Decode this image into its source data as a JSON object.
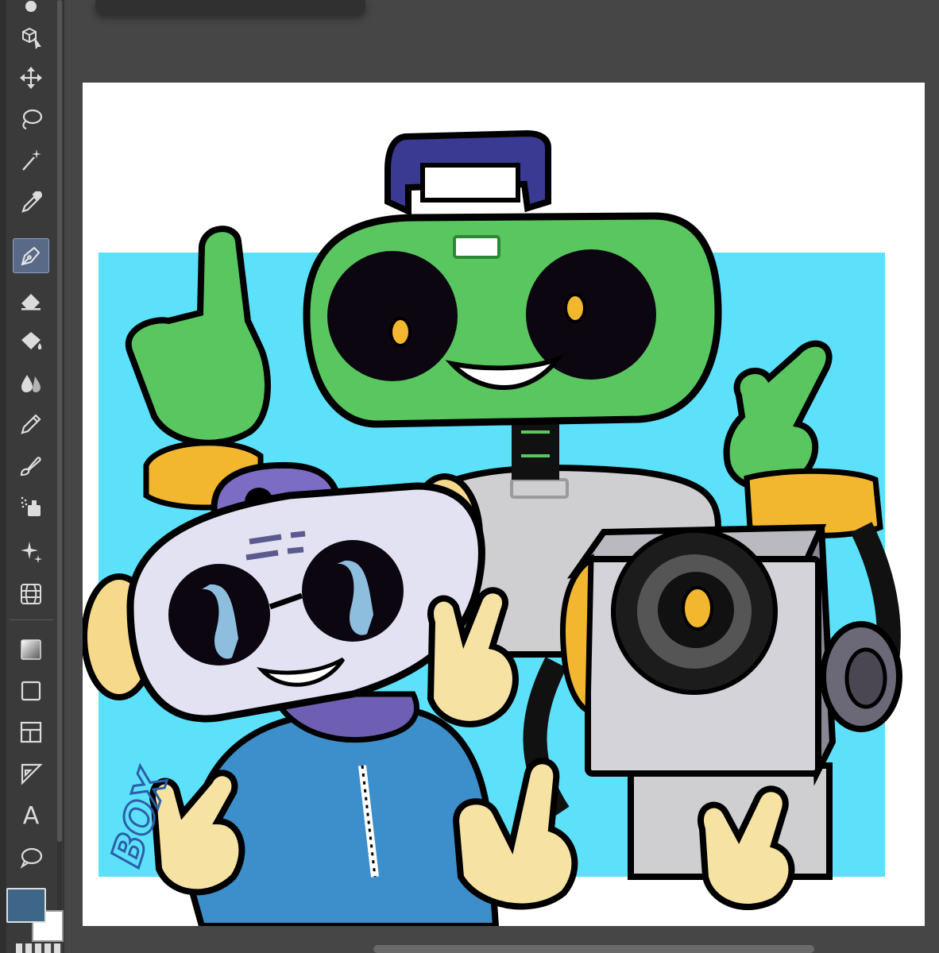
{
  "app": {
    "toolbar": {
      "tools": [
        {
          "name": "object-select-tool",
          "icon": "object-select-icon"
        },
        {
          "name": "move-tool",
          "icon": "move-arrows-icon"
        },
        {
          "name": "lasso-tool",
          "icon": "lasso-icon"
        },
        {
          "name": "magic-wand-tool",
          "icon": "magic-wand-icon"
        },
        {
          "name": "eyedropper-tool",
          "icon": "eyedropper-icon"
        },
        {
          "name": "pen-tool",
          "icon": "pen-nib-icon",
          "active": true
        },
        {
          "name": "eraser-tool",
          "icon": "eraser-icon"
        },
        {
          "name": "fill-tool",
          "icon": "paint-bucket-icon"
        },
        {
          "name": "blend-tool",
          "icon": "water-drops-icon"
        },
        {
          "name": "pencil-tool",
          "icon": "pencil-icon"
        },
        {
          "name": "brush-tool",
          "icon": "brush-icon"
        },
        {
          "name": "airbrush-tool",
          "icon": "airbrush-icon"
        },
        {
          "name": "decoration-tool",
          "icon": "sparkle-icon"
        },
        {
          "name": "mesh-transform-tool",
          "icon": "grid-sphere-icon"
        },
        {
          "name": "gradient-tool",
          "icon": "gradient-icon"
        },
        {
          "name": "figure-tool",
          "icon": "rectangle-icon"
        },
        {
          "name": "frame-tool",
          "icon": "frame-border-icon"
        },
        {
          "name": "ruler-tool",
          "icon": "ruler-triangle-icon"
        },
        {
          "name": "text-tool",
          "icon": "text-icon",
          "glyph": "A"
        },
        {
          "name": "balloon-tool",
          "icon": "speech-balloon-icon"
        }
      ]
    },
    "colors": {
      "main_color": "#3d6688",
      "sub_color": "#ffffff",
      "background_panel": "#5de1fb",
      "canvas": "#ffffff",
      "active_tool": "#596a89"
    },
    "canvas": {
      "artwork": "robot-band-illustration",
      "signature": "BOX"
    }
  }
}
